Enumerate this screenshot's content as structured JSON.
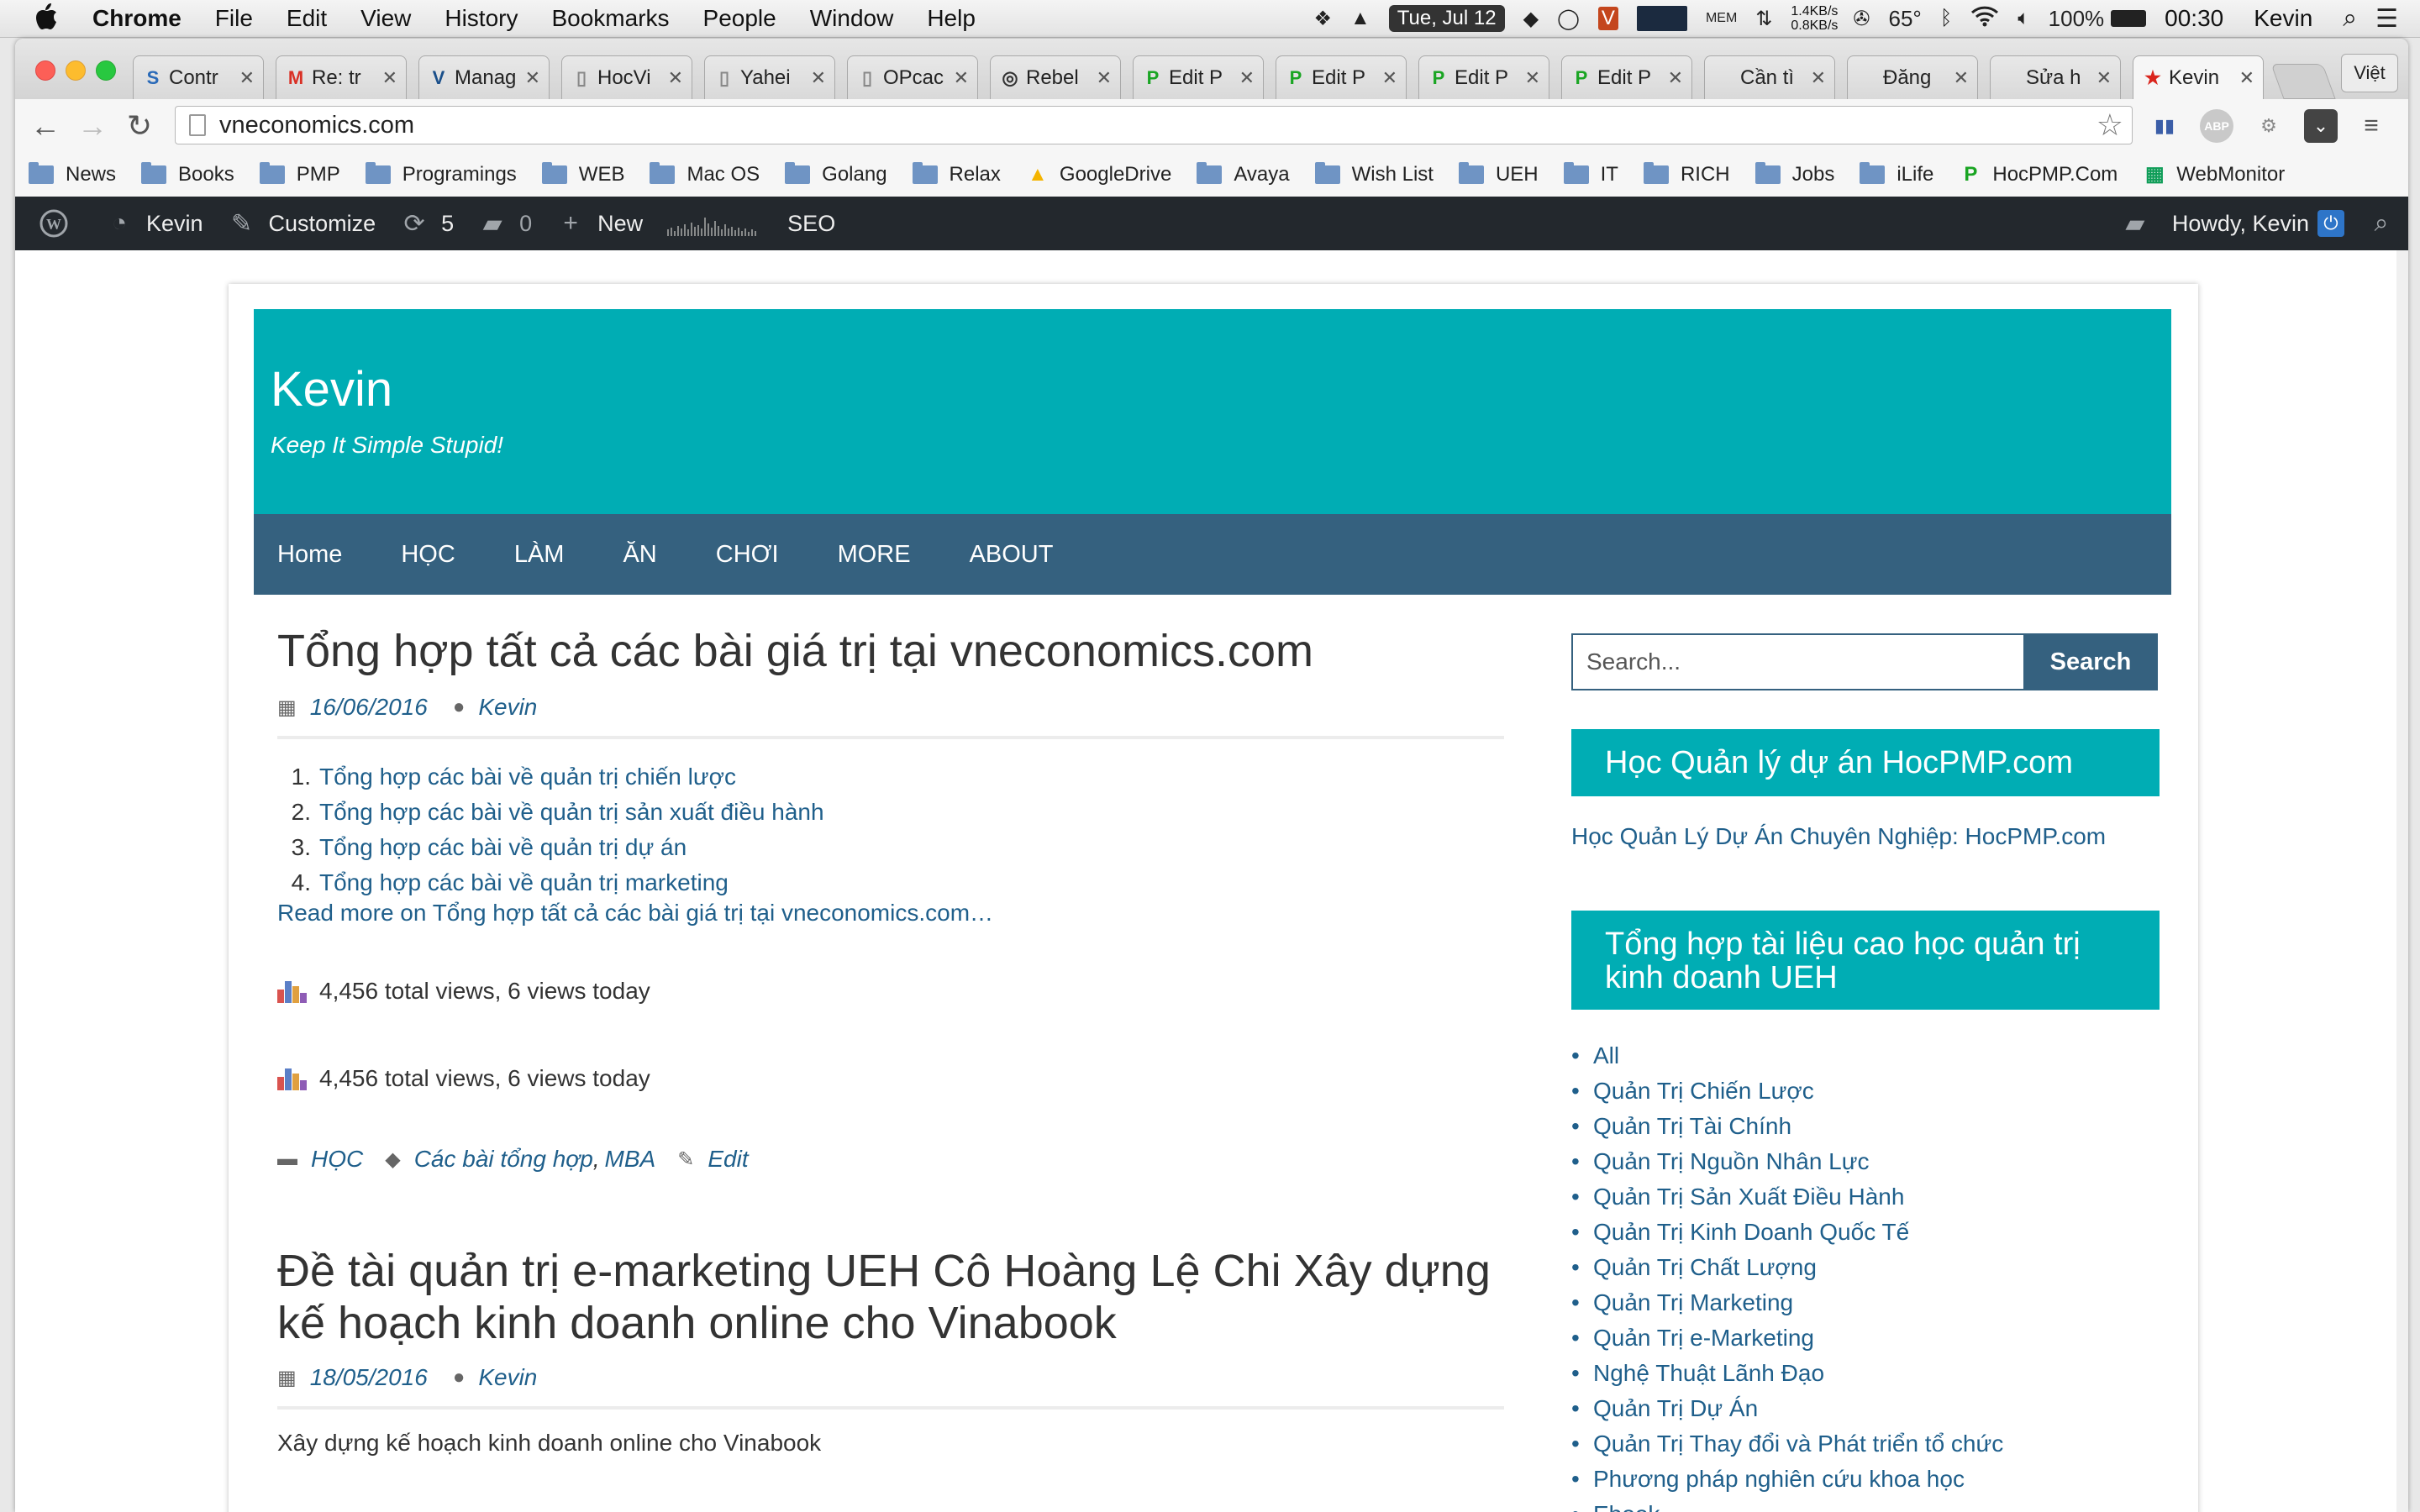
{
  "menubar": {
    "app_name": "Chrome",
    "menus": [
      "File",
      "Edit",
      "View",
      "History",
      "Bookmarks",
      "People",
      "Window",
      "Help"
    ],
    "date": "Tue, Jul 12",
    "net_up": "1.4KB/s",
    "net_down": "0.8KB/s",
    "temperature": "65°",
    "battery": "100%",
    "time": "00:30",
    "user": "Kevin"
  },
  "tabs": [
    {
      "title": "Contr",
      "icon": "S",
      "icon_color": "#2a6ab8"
    },
    {
      "title": "Re: tr",
      "icon": "M",
      "icon_color": "#d93025"
    },
    {
      "title": "Manag",
      "icon": "V",
      "icon_color": "#1a4f8a"
    },
    {
      "title": "HocVi",
      "icon": "▯",
      "icon_color": "#888888"
    },
    {
      "title": "Yahei",
      "icon": "▯",
      "icon_color": "#888888"
    },
    {
      "title": "OPcac",
      "icon": "▯",
      "icon_color": "#888888"
    },
    {
      "title": "Rebel",
      "icon": "◎",
      "icon_color": "#333333"
    },
    {
      "title": "Edit P",
      "icon": "P",
      "icon_color": "#1aa523"
    },
    {
      "title": "Edit P",
      "icon": "P",
      "icon_color": "#1aa523"
    },
    {
      "title": "Edit P",
      "icon": "P",
      "icon_color": "#1aa523"
    },
    {
      "title": "Edit P",
      "icon": "P",
      "icon_color": "#1aa523"
    },
    {
      "title": "Cần tì",
      "icon": "",
      "icon_color": "#888888"
    },
    {
      "title": "Đăng",
      "icon": "",
      "icon_color": "#888888"
    },
    {
      "title": "Sửa h",
      "icon": "",
      "icon_color": "#888888"
    },
    {
      "title": "Kevin",
      "icon": "★",
      "icon_color": "#da251d",
      "active": true
    }
  ],
  "profile_label": "Việt",
  "address": "vneconomics.com",
  "bookmarks": [
    {
      "label": "News",
      "type": "folder"
    },
    {
      "label": "Books",
      "type": "folder"
    },
    {
      "label": "PMP",
      "type": "folder"
    },
    {
      "label": "Programings",
      "type": "folder"
    },
    {
      "label": "WEB",
      "type": "folder"
    },
    {
      "label": "Mac OS",
      "type": "folder"
    },
    {
      "label": "Golang",
      "type": "folder"
    },
    {
      "label": "Relax",
      "type": "folder"
    },
    {
      "label": "GoogleDrive",
      "type": "drive"
    },
    {
      "label": "Avaya",
      "type": "folder"
    },
    {
      "label": "Wish List",
      "type": "folder"
    },
    {
      "label": "UEH",
      "type": "folder"
    },
    {
      "label": "IT",
      "type": "folder"
    },
    {
      "label": "RICH",
      "type": "folder"
    },
    {
      "label": "Jobs",
      "type": "folder"
    },
    {
      "label": "iLife",
      "type": "folder"
    },
    {
      "label": "HocPMP.Com",
      "type": "p"
    },
    {
      "label": "WebMonitor",
      "type": "sheet"
    }
  ],
  "adminbar": {
    "site_name": "Kevin",
    "customize": "Customize",
    "updates_count": "5",
    "comments_count": "0",
    "new_label": "New",
    "seo_label": "SEO",
    "howdy": "Howdy, Kevin"
  },
  "site": {
    "title": "Kevin",
    "description": "Keep It Simple Stupid!",
    "accent": "#00adb4",
    "nav_color": "#35617f",
    "nav": [
      "Home",
      "HỌC",
      "LÀM",
      "ĂN",
      "CHƠI",
      "MORE",
      "ABOUT"
    ]
  },
  "posts": [
    {
      "title": "Tổng hợp tất cả các bài giá trị tại vneconomics.com",
      "date": "16/06/2016",
      "author": "Kevin",
      "list": [
        "Tổng hợp các bài về quản trị chiến lược",
        "Tổng hợp các bài về quản trị sản xuất điều hành",
        "Tổng hợp các bài về quản trị dự án",
        "Tổng hợp các bài về quản trị marketing"
      ],
      "read_more": "Read more on Tổng hợp tất cả các bài giá trị tại vneconomics.com…",
      "views_1": "4,456 total views, 6 views today",
      "views_2": "4,456 total views, 6 views today",
      "category": "HỌC",
      "tag_1": "Các bài tổng hợp",
      "tag_separator": ",",
      "tag_2": "MBA",
      "edit": "Edit"
    },
    {
      "title_line_1": "Đề tài quản trị e-marketing UEH Cô Hoàng Lệ Chi Xây dựng",
      "title_line_2": "kế hoạch kinh doanh online cho Vinabook",
      "date": "18/05/2016",
      "author": "Kevin",
      "excerpt": "Xây dựng kế hoạch kinh doanh online cho Vinabook"
    }
  ],
  "sidebar": {
    "search_placeholder": "Search...",
    "search_button": "Search",
    "widget1_title": "Học Quản lý dự án HocPMP.com",
    "widget1_link": "Học Quản Lý Dự Án Chuyên Nghiệp: HocPMP.com",
    "widget2_title_line_1": "Tổng hợp tài liệu cao học quản trị",
    "widget2_title_line_2": "kinh doanh UEH",
    "widget2_items": [
      "All",
      "Quản Trị Chiến Lược",
      "Quản Trị Tài Chính",
      "Quản Trị Nguồn Nhân Lực",
      "Quản Trị Sản Xuất Điều Hành",
      "Quản Trị Kinh Doanh Quốc Tế",
      "Quản Trị Chất Lượng",
      "Quản Trị Marketing",
      "Quản Trị e-Marketing",
      "Nghệ Thuật Lãnh Đạo",
      "Quản Trị Dự Án",
      "Quản Trị Thay đổi và Phát triển tổ chức",
      "Phương pháp nghiên cứu khoa học",
      "Ebook"
    ]
  }
}
